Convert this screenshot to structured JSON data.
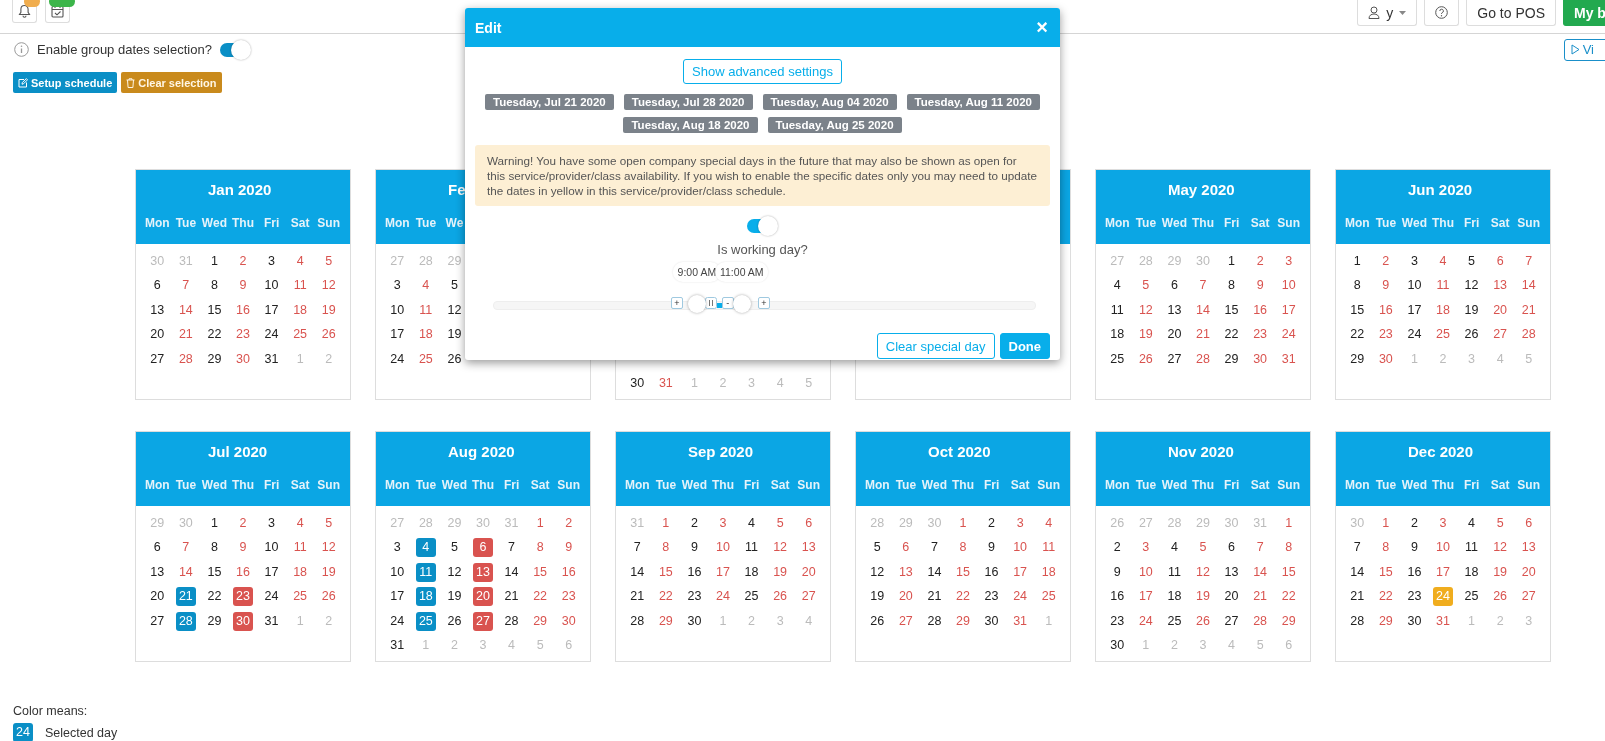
{
  "topbar": {
    "icons": [
      {
        "kind": "bell",
        "color": "#f0ad4e"
      },
      {
        "kind": "calendar",
        "color": "#3cb54a"
      }
    ],
    "user": {
      "label": "y"
    },
    "buttons": [
      {
        "label": "Go to POS",
        "kind": "default"
      },
      {
        "label": "My b",
        "kind": "primary"
      }
    ]
  },
  "group_selection": {
    "label": "Enable group dates selection?",
    "on": true
  },
  "view_button": {
    "label": "Vi"
  },
  "actions": [
    {
      "label": "Setup schedule",
      "kind": "primary",
      "disabled": false
    },
    {
      "label": "Clear selection",
      "kind": "warning",
      "disabled": true
    }
  ],
  "calendars": [
    {
      "kind": "month",
      "title": "Jan 2020",
      "weekdays": [
        "Mon",
        "Tue",
        "Wed",
        "Thu",
        "Fri",
        "Sat",
        "Sun"
      ],
      "weeks": [
        [
          {
            "day": "30",
            "kind": "muted"
          },
          {
            "day": "31",
            "kind": "muted"
          },
          {
            "day": "1",
            "kind": "open"
          },
          {
            "day": "2",
            "kind": "closed"
          },
          {
            "day": "3",
            "kind": "open"
          },
          {
            "day": "4",
            "kind": "closed"
          },
          {
            "day": "5",
            "kind": "closed"
          }
        ],
        [
          {
            "day": "6",
            "kind": "open"
          },
          {
            "day": "7",
            "kind": "closed"
          },
          {
            "day": "8",
            "kind": "open"
          },
          {
            "day": "9",
            "kind": "closed"
          },
          {
            "day": "10",
            "kind": "open"
          },
          {
            "day": "11",
            "kind": "closed"
          },
          {
            "day": "12",
            "kind": "closed"
          }
        ],
        [
          {
            "day": "13",
            "kind": "open"
          },
          {
            "day": "14",
            "kind": "closed"
          },
          {
            "day": "15",
            "kind": "open"
          },
          {
            "day": "16",
            "kind": "closed"
          },
          {
            "day": "17",
            "kind": "open"
          },
          {
            "day": "18",
            "kind": "closed"
          },
          {
            "day": "19",
            "kind": "closed"
          }
        ],
        [
          {
            "day": "20",
            "kind": "open"
          },
          {
            "day": "21",
            "kind": "closed"
          },
          {
            "day": "22",
            "kind": "open"
          },
          {
            "day": "23",
            "kind": "closed"
          },
          {
            "day": "24",
            "kind": "open"
          },
          {
            "day": "25",
            "kind": "closed"
          },
          {
            "day": "26",
            "kind": "closed"
          }
        ],
        [
          {
            "day": "27",
            "kind": "open"
          },
          {
            "day": "28",
            "kind": "closed"
          },
          {
            "day": "29",
            "kind": "open"
          },
          {
            "day": "30",
            "kind": "closed"
          },
          {
            "day": "31",
            "kind": "open"
          },
          {
            "day": "1",
            "kind": "muted"
          },
          {
            "day": "2",
            "kind": "muted"
          }
        ]
      ]
    },
    {
      "kind": "month",
      "title": "Fe",
      "weekdays": [
        "Mon",
        "Tue",
        "We"
      ],
      "weeks": [
        [
          {
            "day": "27",
            "kind": "muted"
          },
          {
            "day": "28",
            "kind": "muted"
          },
          {
            "day": "29",
            "kind": "muted"
          }
        ],
        [
          {
            "day": "3",
            "kind": "open"
          },
          {
            "day": "4",
            "kind": "closed"
          },
          {
            "day": "5",
            "kind": "open"
          }
        ],
        [
          {
            "day": "10",
            "kind": "open"
          },
          {
            "day": "11",
            "kind": "closed"
          },
          {
            "day": "12",
            "kind": "open"
          }
        ],
        [
          {
            "day": "17",
            "kind": "open"
          },
          {
            "day": "18",
            "kind": "closed"
          },
          {
            "day": "19",
            "kind": "open"
          }
        ],
        [
          {
            "day": "24",
            "kind": "open"
          },
          {
            "day": "25",
            "kind": "closed"
          },
          {
            "day": "26",
            "kind": "open"
          }
        ]
      ]
    },
    {
      "kind": "bottom_rows",
      "weeks": [
        [
          {
            "day": "30",
            "kind": "open"
          },
          {
            "day": "31",
            "kind": "closed"
          },
          {
            "day": "1",
            "kind": "muted"
          },
          {
            "day": "2",
            "kind": "muted"
          },
          {
            "day": "3",
            "kind": "muted"
          },
          {
            "day": "4",
            "kind": "muted"
          },
          {
            "day": "5",
            "kind": "muted"
          }
        ]
      ]
    },
    {
      "kind": "covered"
    },
    {
      "kind": "month",
      "title": "May 2020",
      "weekdays": [
        "Mon",
        "Tue",
        "Wed",
        "Thu",
        "Fri",
        "Sat",
        "Sun"
      ],
      "weeks": [
        [
          {
            "day": "27",
            "kind": "muted"
          },
          {
            "day": "28",
            "kind": "muted"
          },
          {
            "day": "29",
            "kind": "muted"
          },
          {
            "day": "30",
            "kind": "muted"
          },
          {
            "day": "1",
            "kind": "open"
          },
          {
            "day": "2",
            "kind": "closed"
          },
          {
            "day": "3",
            "kind": "closed"
          }
        ],
        [
          {
            "day": "4",
            "kind": "open"
          },
          {
            "day": "5",
            "kind": "closed"
          },
          {
            "day": "6",
            "kind": "open"
          },
          {
            "day": "7",
            "kind": "closed"
          },
          {
            "day": "8",
            "kind": "open"
          },
          {
            "day": "9",
            "kind": "closed"
          },
          {
            "day": "10",
            "kind": "closed"
          }
        ],
        [
          {
            "day": "11",
            "kind": "open"
          },
          {
            "day": "12",
            "kind": "closed"
          },
          {
            "day": "13",
            "kind": "open"
          },
          {
            "day": "14",
            "kind": "closed"
          },
          {
            "day": "15",
            "kind": "open"
          },
          {
            "day": "16",
            "kind": "closed"
          },
          {
            "day": "17",
            "kind": "closed"
          }
        ],
        [
          {
            "day": "18",
            "kind": "open"
          },
          {
            "day": "19",
            "kind": "closed"
          },
          {
            "day": "20",
            "kind": "open"
          },
          {
            "day": "21",
            "kind": "closed"
          },
          {
            "day": "22",
            "kind": "open"
          },
          {
            "day": "23",
            "kind": "closed"
          },
          {
            "day": "24",
            "kind": "closed"
          }
        ],
        [
          {
            "day": "25",
            "kind": "open"
          },
          {
            "day": "26",
            "kind": "closed"
          },
          {
            "day": "27",
            "kind": "open"
          },
          {
            "day": "28",
            "kind": "closed"
          },
          {
            "day": "29",
            "kind": "open"
          },
          {
            "day": "30",
            "kind": "closed"
          },
          {
            "day": "31",
            "kind": "closed"
          }
        ]
      ]
    },
    {
      "kind": "month",
      "title": "Jun 2020",
      "weekdays": [
        "Mon",
        "Tue",
        "Wed",
        "Thu",
        "Fri",
        "Sat",
        "Sun"
      ],
      "weeks": [
        [
          {
            "day": "1",
            "kind": "open"
          },
          {
            "day": "2",
            "kind": "closed"
          },
          {
            "day": "3",
            "kind": "open"
          },
          {
            "day": "4",
            "kind": "closed"
          },
          {
            "day": "5",
            "kind": "open"
          },
          {
            "day": "6",
            "kind": "closed"
          },
          {
            "day": "7",
            "kind": "closed"
          }
        ],
        [
          {
            "day": "8",
            "kind": "open"
          },
          {
            "day": "9",
            "kind": "closed"
          },
          {
            "day": "10",
            "kind": "open"
          },
          {
            "day": "11",
            "kind": "closed"
          },
          {
            "day": "12",
            "kind": "open"
          },
          {
            "day": "13",
            "kind": "closed"
          },
          {
            "day": "14",
            "kind": "closed"
          }
        ],
        [
          {
            "day": "15",
            "kind": "open"
          },
          {
            "day": "16",
            "kind": "closed"
          },
          {
            "day": "17",
            "kind": "open"
          },
          {
            "day": "18",
            "kind": "closed"
          },
          {
            "day": "19",
            "kind": "open"
          },
          {
            "day": "20",
            "kind": "closed"
          },
          {
            "day": "21",
            "kind": "closed"
          }
        ],
        [
          {
            "day": "22",
            "kind": "open"
          },
          {
            "day": "23",
            "kind": "closed"
          },
          {
            "day": "24",
            "kind": "open"
          },
          {
            "day": "25",
            "kind": "closed"
          },
          {
            "day": "26",
            "kind": "open"
          },
          {
            "day": "27",
            "kind": "closed"
          },
          {
            "day": "28",
            "kind": "closed"
          }
        ],
        [
          {
            "day": "29",
            "kind": "open"
          },
          {
            "day": "30",
            "kind": "closed"
          },
          {
            "day": "1",
            "kind": "muted"
          },
          {
            "day": "2",
            "kind": "muted"
          },
          {
            "day": "3",
            "kind": "muted"
          },
          {
            "day": "4",
            "kind": "muted"
          },
          {
            "day": "5",
            "kind": "muted"
          }
        ]
      ]
    },
    {
      "kind": "month",
      "title": "Jul 2020",
      "weekdays": [
        "Mon",
        "Tue",
        "Wed",
        "Thu",
        "Fri",
        "Sat",
        "Sun"
      ],
      "weeks": [
        [
          {
            "day": "29",
            "kind": "muted"
          },
          {
            "day": "30",
            "kind": "muted"
          },
          {
            "day": "1",
            "kind": "open"
          },
          {
            "day": "2",
            "kind": "closed"
          },
          {
            "day": "3",
            "kind": "open"
          },
          {
            "day": "4",
            "kind": "closed"
          },
          {
            "day": "5",
            "kind": "closed"
          }
        ],
        [
          {
            "day": "6",
            "kind": "open"
          },
          {
            "day": "7",
            "kind": "closed"
          },
          {
            "day": "8",
            "kind": "open"
          },
          {
            "day": "9",
            "kind": "closed"
          },
          {
            "day": "10",
            "kind": "open"
          },
          {
            "day": "11",
            "kind": "closed"
          },
          {
            "day": "12",
            "kind": "closed"
          }
        ],
        [
          {
            "day": "13",
            "kind": "open"
          },
          {
            "day": "14",
            "kind": "closed"
          },
          {
            "day": "15",
            "kind": "open"
          },
          {
            "day": "16",
            "kind": "closed"
          },
          {
            "day": "17",
            "kind": "open"
          },
          {
            "day": "18",
            "kind": "closed"
          },
          {
            "day": "19",
            "kind": "closed"
          }
        ],
        [
          {
            "day": "20",
            "kind": "open"
          },
          {
            "day": "21",
            "kind": "selected"
          },
          {
            "day": "22",
            "kind": "open"
          },
          {
            "day": "23",
            "kind": "special"
          },
          {
            "day": "24",
            "kind": "open"
          },
          {
            "day": "25",
            "kind": "closed"
          },
          {
            "day": "26",
            "kind": "closed"
          }
        ],
        [
          {
            "day": "27",
            "kind": "open"
          },
          {
            "day": "28",
            "kind": "selected"
          },
          {
            "day": "29",
            "kind": "open"
          },
          {
            "day": "30",
            "kind": "special"
          },
          {
            "day": "31",
            "kind": "open"
          },
          {
            "day": "1",
            "kind": "muted"
          },
          {
            "day": "2",
            "kind": "muted"
          }
        ]
      ]
    },
    {
      "kind": "month",
      "title": "Aug 2020",
      "weekdays": [
        "Mon",
        "Tue",
        "Wed",
        "Thu",
        "Fri",
        "Sat",
        "Sun"
      ],
      "weeks": [
        [
          {
            "day": "27",
            "kind": "muted"
          },
          {
            "day": "28",
            "kind": "muted"
          },
          {
            "day": "29",
            "kind": "muted"
          },
          {
            "day": "30",
            "kind": "muted"
          },
          {
            "day": "31",
            "kind": "muted"
          },
          {
            "day": "1",
            "kind": "closed"
          },
          {
            "day": "2",
            "kind": "closed"
          }
        ],
        [
          {
            "day": "3",
            "kind": "open"
          },
          {
            "day": "4",
            "kind": "selected"
          },
          {
            "day": "5",
            "kind": "open"
          },
          {
            "day": "6",
            "kind": "special"
          },
          {
            "day": "7",
            "kind": "open"
          },
          {
            "day": "8",
            "kind": "closed"
          },
          {
            "day": "9",
            "kind": "closed"
          }
        ],
        [
          {
            "day": "10",
            "kind": "open"
          },
          {
            "day": "11",
            "kind": "selected"
          },
          {
            "day": "12",
            "kind": "open"
          },
          {
            "day": "13",
            "kind": "special"
          },
          {
            "day": "14",
            "kind": "open"
          },
          {
            "day": "15",
            "kind": "closed"
          },
          {
            "day": "16",
            "kind": "closed"
          }
        ],
        [
          {
            "day": "17",
            "kind": "open"
          },
          {
            "day": "18",
            "kind": "selected"
          },
          {
            "day": "19",
            "kind": "open"
          },
          {
            "day": "20",
            "kind": "special"
          },
          {
            "day": "21",
            "kind": "open"
          },
          {
            "day": "22",
            "kind": "closed"
          },
          {
            "day": "23",
            "kind": "closed"
          }
        ],
        [
          {
            "day": "24",
            "kind": "open"
          },
          {
            "day": "25",
            "kind": "selected"
          },
          {
            "day": "26",
            "kind": "open"
          },
          {
            "day": "27",
            "kind": "special"
          },
          {
            "day": "28",
            "kind": "open"
          },
          {
            "day": "29",
            "kind": "closed"
          },
          {
            "day": "30",
            "kind": "closed"
          }
        ],
        [
          {
            "day": "31",
            "kind": "open"
          },
          {
            "day": "1",
            "kind": "muted"
          },
          {
            "day": "2",
            "kind": "muted"
          },
          {
            "day": "3",
            "kind": "muted"
          },
          {
            "day": "4",
            "kind": "muted"
          },
          {
            "day": "5",
            "kind": "muted"
          },
          {
            "day": "6",
            "kind": "muted"
          }
        ]
      ]
    },
    {
      "kind": "month",
      "title": "Sep 2020",
      "weekdays": [
        "Mon",
        "Tue",
        "Wed",
        "Thu",
        "Fri",
        "Sat",
        "Sun"
      ],
      "weeks": [
        [
          {
            "day": "31",
            "kind": "muted"
          },
          {
            "day": "1",
            "kind": "closed"
          },
          {
            "day": "2",
            "kind": "open"
          },
          {
            "day": "3",
            "kind": "closed"
          },
          {
            "day": "4",
            "kind": "open"
          },
          {
            "day": "5",
            "kind": "closed"
          },
          {
            "day": "6",
            "kind": "closed"
          }
        ],
        [
          {
            "day": "7",
            "kind": "open"
          },
          {
            "day": "8",
            "kind": "closed"
          },
          {
            "day": "9",
            "kind": "open"
          },
          {
            "day": "10",
            "kind": "closed"
          },
          {
            "day": "11",
            "kind": "open"
          },
          {
            "day": "12",
            "kind": "closed"
          },
          {
            "day": "13",
            "kind": "closed"
          }
        ],
        [
          {
            "day": "14",
            "kind": "open"
          },
          {
            "day": "15",
            "kind": "closed"
          },
          {
            "day": "16",
            "kind": "open"
          },
          {
            "day": "17",
            "kind": "closed"
          },
          {
            "day": "18",
            "kind": "open"
          },
          {
            "day": "19",
            "kind": "closed"
          },
          {
            "day": "20",
            "kind": "closed"
          }
        ],
        [
          {
            "day": "21",
            "kind": "open"
          },
          {
            "day": "22",
            "kind": "closed"
          },
          {
            "day": "23",
            "kind": "open"
          },
          {
            "day": "24",
            "kind": "closed"
          },
          {
            "day": "25",
            "kind": "open"
          },
          {
            "day": "26",
            "kind": "closed"
          },
          {
            "day": "27",
            "kind": "closed"
          }
        ],
        [
          {
            "day": "28",
            "kind": "open"
          },
          {
            "day": "29",
            "kind": "closed"
          },
          {
            "day": "30",
            "kind": "open"
          },
          {
            "day": "1",
            "kind": "muted"
          },
          {
            "day": "2",
            "kind": "muted"
          },
          {
            "day": "3",
            "kind": "muted"
          },
          {
            "day": "4",
            "kind": "muted"
          }
        ]
      ]
    },
    {
      "kind": "month",
      "title": "Oct 2020",
      "weekdays": [
        "Mon",
        "Tue",
        "Wed",
        "Thu",
        "Fri",
        "Sat",
        "Sun"
      ],
      "weeks": [
        [
          {
            "day": "28",
            "kind": "muted"
          },
          {
            "day": "29",
            "kind": "muted"
          },
          {
            "day": "30",
            "kind": "muted"
          },
          {
            "day": "1",
            "kind": "closed"
          },
          {
            "day": "2",
            "kind": "open"
          },
          {
            "day": "3",
            "kind": "closed"
          },
          {
            "day": "4",
            "kind": "closed"
          }
        ],
        [
          {
            "day": "5",
            "kind": "open"
          },
          {
            "day": "6",
            "kind": "closed"
          },
          {
            "day": "7",
            "kind": "open"
          },
          {
            "day": "8",
            "kind": "closed"
          },
          {
            "day": "9",
            "kind": "open"
          },
          {
            "day": "10",
            "kind": "closed"
          },
          {
            "day": "11",
            "kind": "closed"
          }
        ],
        [
          {
            "day": "12",
            "kind": "open"
          },
          {
            "day": "13",
            "kind": "closed"
          },
          {
            "day": "14",
            "kind": "open"
          },
          {
            "day": "15",
            "kind": "closed"
          },
          {
            "day": "16",
            "kind": "open"
          },
          {
            "day": "17",
            "kind": "closed"
          },
          {
            "day": "18",
            "kind": "closed"
          }
        ],
        [
          {
            "day": "19",
            "kind": "open"
          },
          {
            "day": "20",
            "kind": "closed"
          },
          {
            "day": "21",
            "kind": "open"
          },
          {
            "day": "22",
            "kind": "closed"
          },
          {
            "day": "23",
            "kind": "open"
          },
          {
            "day": "24",
            "kind": "closed"
          },
          {
            "day": "25",
            "kind": "closed"
          }
        ],
        [
          {
            "day": "26",
            "kind": "open"
          },
          {
            "day": "27",
            "kind": "closed"
          },
          {
            "day": "28",
            "kind": "open"
          },
          {
            "day": "29",
            "kind": "closed"
          },
          {
            "day": "30",
            "kind": "open"
          },
          {
            "day": "31",
            "kind": "closed"
          },
          {
            "day": "1",
            "kind": "muted"
          }
        ]
      ]
    },
    {
      "kind": "month",
      "title": "Nov 2020",
      "weekdays": [
        "Mon",
        "Tue",
        "Wed",
        "Thu",
        "Fri",
        "Sat",
        "Sun"
      ],
      "weeks": [
        [
          {
            "day": "26",
            "kind": "muted"
          },
          {
            "day": "27",
            "kind": "muted"
          },
          {
            "day": "28",
            "kind": "muted"
          },
          {
            "day": "29",
            "kind": "muted"
          },
          {
            "day": "30",
            "kind": "muted"
          },
          {
            "day": "31",
            "kind": "muted"
          },
          {
            "day": "1",
            "kind": "closed"
          }
        ],
        [
          {
            "day": "2",
            "kind": "open"
          },
          {
            "day": "3",
            "kind": "closed"
          },
          {
            "day": "4",
            "kind": "open"
          },
          {
            "day": "5",
            "kind": "closed"
          },
          {
            "day": "6",
            "kind": "open"
          },
          {
            "day": "7",
            "kind": "closed"
          },
          {
            "day": "8",
            "kind": "closed"
          }
        ],
        [
          {
            "day": "9",
            "kind": "open"
          },
          {
            "day": "10",
            "kind": "closed"
          },
          {
            "day": "11",
            "kind": "open"
          },
          {
            "day": "12",
            "kind": "closed"
          },
          {
            "day": "13",
            "kind": "open"
          },
          {
            "day": "14",
            "kind": "closed"
          },
          {
            "day": "15",
            "kind": "closed"
          }
        ],
        [
          {
            "day": "16",
            "kind": "open"
          },
          {
            "day": "17",
            "kind": "closed"
          },
          {
            "day": "18",
            "kind": "open"
          },
          {
            "day": "19",
            "kind": "closed"
          },
          {
            "day": "20",
            "kind": "open"
          },
          {
            "day": "21",
            "kind": "closed"
          },
          {
            "day": "22",
            "kind": "closed"
          }
        ],
        [
          {
            "day": "23",
            "kind": "open"
          },
          {
            "day": "24",
            "kind": "closed"
          },
          {
            "day": "25",
            "kind": "open"
          },
          {
            "day": "26",
            "kind": "closed"
          },
          {
            "day": "27",
            "kind": "open"
          },
          {
            "day": "28",
            "kind": "closed"
          },
          {
            "day": "29",
            "kind": "closed"
          }
        ],
        [
          {
            "day": "30",
            "kind": "open"
          },
          {
            "day": "1",
            "kind": "muted"
          },
          {
            "day": "2",
            "kind": "muted"
          },
          {
            "day": "3",
            "kind": "muted"
          },
          {
            "day": "4",
            "kind": "muted"
          },
          {
            "day": "5",
            "kind": "muted"
          },
          {
            "day": "6",
            "kind": "muted"
          }
        ]
      ]
    },
    {
      "kind": "month",
      "title": "Dec 2020",
      "weekdays": [
        "Mon",
        "Tue",
        "Wed",
        "Thu",
        "Fri",
        "Sat",
        "Sun"
      ],
      "weeks": [
        [
          {
            "day": "30",
            "kind": "muted"
          },
          {
            "day": "1",
            "kind": "closed"
          },
          {
            "day": "2",
            "kind": "open"
          },
          {
            "day": "3",
            "kind": "closed"
          },
          {
            "day": "4",
            "kind": "open"
          },
          {
            "day": "5",
            "kind": "closed"
          },
          {
            "day": "6",
            "kind": "closed"
          }
        ],
        [
          {
            "day": "7",
            "kind": "open"
          },
          {
            "day": "8",
            "kind": "closed"
          },
          {
            "day": "9",
            "kind": "open"
          },
          {
            "day": "10",
            "kind": "closed"
          },
          {
            "day": "11",
            "kind": "open"
          },
          {
            "day": "12",
            "kind": "closed"
          },
          {
            "day": "13",
            "kind": "closed"
          }
        ],
        [
          {
            "day": "14",
            "kind": "open"
          },
          {
            "day": "15",
            "kind": "closed"
          },
          {
            "day": "16",
            "kind": "open"
          },
          {
            "day": "17",
            "kind": "closed"
          },
          {
            "day": "18",
            "kind": "open"
          },
          {
            "day": "19",
            "kind": "closed"
          },
          {
            "day": "20",
            "kind": "closed"
          }
        ],
        [
          {
            "day": "21",
            "kind": "open"
          },
          {
            "day": "22",
            "kind": "closed"
          },
          {
            "day": "23",
            "kind": "open"
          },
          {
            "day": "24",
            "kind": "highlight"
          },
          {
            "day": "25",
            "kind": "open"
          },
          {
            "day": "26",
            "kind": "closed"
          },
          {
            "day": "27",
            "kind": "closed"
          }
        ],
        [
          {
            "day": "28",
            "kind": "open"
          },
          {
            "day": "29",
            "kind": "closed"
          },
          {
            "day": "30",
            "kind": "open"
          },
          {
            "day": "31",
            "kind": "closed"
          },
          {
            "day": "1",
            "kind": "muted"
          },
          {
            "day": "2",
            "kind": "muted"
          },
          {
            "day": "3",
            "kind": "muted"
          }
        ]
      ]
    }
  ],
  "legend": {
    "title": "Color means:",
    "items": [
      {
        "sample": "24",
        "kind": "selected",
        "label": "Selected day"
      }
    ]
  },
  "modal": {
    "title": "Edit",
    "close": "×",
    "advanced_button": "Show advanced settings",
    "dates": [
      "Tuesday, Jul 21 2020",
      "Tuesday, Jul 28 2020",
      "Tuesday, Aug 04 2020",
      "Tuesday, Aug 11 2020",
      "Tuesday, Aug 18 2020",
      "Tuesday, Aug 25 2020"
    ],
    "warning": "Warning! You have some open company special days in the future that may also be shown as open for this service/provider/class availability. If you wish to enable the specific dates only you may need to update the dates in yellow in this service/provider/class schedule.",
    "working_day": {
      "label": "Is working day?",
      "on": true
    },
    "time_range": {
      "thumbs": [
        {
          "label": "9:00 AM",
          "level": 0.375
        },
        {
          "label": "11:00 AM",
          "level": 0.458
        }
      ],
      "buttons": [
        "+",
        "-",
        "+"
      ]
    },
    "footer_buttons": [
      {
        "label": "Clear special day",
        "kind": "outline"
      },
      {
        "label": "Done",
        "kind": "primary"
      }
    ]
  }
}
